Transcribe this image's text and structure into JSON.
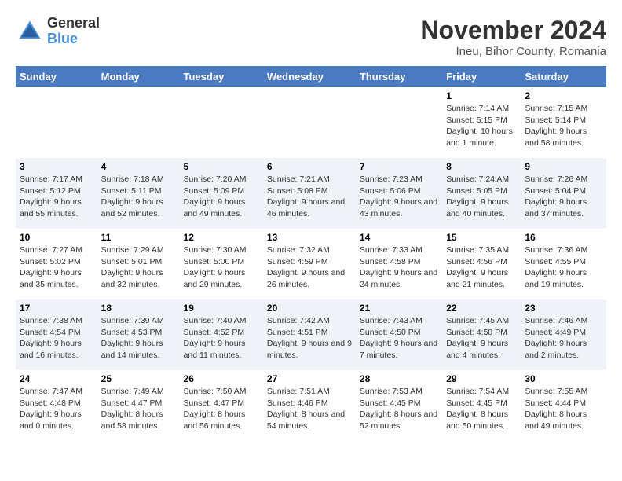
{
  "header": {
    "logo_line1": "General",
    "logo_line2": "Blue",
    "main_title": "November 2024",
    "subtitle": "Ineu, Bihor County, Romania"
  },
  "calendar": {
    "days_of_week": [
      "Sunday",
      "Monday",
      "Tuesday",
      "Wednesday",
      "Thursday",
      "Friday",
      "Saturday"
    ],
    "weeks": [
      [
        {
          "day": "",
          "info": ""
        },
        {
          "day": "",
          "info": ""
        },
        {
          "day": "",
          "info": ""
        },
        {
          "day": "",
          "info": ""
        },
        {
          "day": "",
          "info": ""
        },
        {
          "day": "1",
          "info": "Sunrise: 7:14 AM\nSunset: 5:15 PM\nDaylight: 10 hours and 1 minute."
        },
        {
          "day": "2",
          "info": "Sunrise: 7:15 AM\nSunset: 5:14 PM\nDaylight: 9 hours and 58 minutes."
        }
      ],
      [
        {
          "day": "3",
          "info": "Sunrise: 7:17 AM\nSunset: 5:12 PM\nDaylight: 9 hours and 55 minutes."
        },
        {
          "day": "4",
          "info": "Sunrise: 7:18 AM\nSunset: 5:11 PM\nDaylight: 9 hours and 52 minutes."
        },
        {
          "day": "5",
          "info": "Sunrise: 7:20 AM\nSunset: 5:09 PM\nDaylight: 9 hours and 49 minutes."
        },
        {
          "day": "6",
          "info": "Sunrise: 7:21 AM\nSunset: 5:08 PM\nDaylight: 9 hours and 46 minutes."
        },
        {
          "day": "7",
          "info": "Sunrise: 7:23 AM\nSunset: 5:06 PM\nDaylight: 9 hours and 43 minutes."
        },
        {
          "day": "8",
          "info": "Sunrise: 7:24 AM\nSunset: 5:05 PM\nDaylight: 9 hours and 40 minutes."
        },
        {
          "day": "9",
          "info": "Sunrise: 7:26 AM\nSunset: 5:04 PM\nDaylight: 9 hours and 37 minutes."
        }
      ],
      [
        {
          "day": "10",
          "info": "Sunrise: 7:27 AM\nSunset: 5:02 PM\nDaylight: 9 hours and 35 minutes."
        },
        {
          "day": "11",
          "info": "Sunrise: 7:29 AM\nSunset: 5:01 PM\nDaylight: 9 hours and 32 minutes."
        },
        {
          "day": "12",
          "info": "Sunrise: 7:30 AM\nSunset: 5:00 PM\nDaylight: 9 hours and 29 minutes."
        },
        {
          "day": "13",
          "info": "Sunrise: 7:32 AM\nSunset: 4:59 PM\nDaylight: 9 hours and 26 minutes."
        },
        {
          "day": "14",
          "info": "Sunrise: 7:33 AM\nSunset: 4:58 PM\nDaylight: 9 hours and 24 minutes."
        },
        {
          "day": "15",
          "info": "Sunrise: 7:35 AM\nSunset: 4:56 PM\nDaylight: 9 hours and 21 minutes."
        },
        {
          "day": "16",
          "info": "Sunrise: 7:36 AM\nSunset: 4:55 PM\nDaylight: 9 hours and 19 minutes."
        }
      ],
      [
        {
          "day": "17",
          "info": "Sunrise: 7:38 AM\nSunset: 4:54 PM\nDaylight: 9 hours and 16 minutes."
        },
        {
          "day": "18",
          "info": "Sunrise: 7:39 AM\nSunset: 4:53 PM\nDaylight: 9 hours and 14 minutes."
        },
        {
          "day": "19",
          "info": "Sunrise: 7:40 AM\nSunset: 4:52 PM\nDaylight: 9 hours and 11 minutes."
        },
        {
          "day": "20",
          "info": "Sunrise: 7:42 AM\nSunset: 4:51 PM\nDaylight: 9 hours and 9 minutes."
        },
        {
          "day": "21",
          "info": "Sunrise: 7:43 AM\nSunset: 4:50 PM\nDaylight: 9 hours and 7 minutes."
        },
        {
          "day": "22",
          "info": "Sunrise: 7:45 AM\nSunset: 4:50 PM\nDaylight: 9 hours and 4 minutes."
        },
        {
          "day": "23",
          "info": "Sunrise: 7:46 AM\nSunset: 4:49 PM\nDaylight: 9 hours and 2 minutes."
        }
      ],
      [
        {
          "day": "24",
          "info": "Sunrise: 7:47 AM\nSunset: 4:48 PM\nDaylight: 9 hours and 0 minutes."
        },
        {
          "day": "25",
          "info": "Sunrise: 7:49 AM\nSunset: 4:47 PM\nDaylight: 8 hours and 58 minutes."
        },
        {
          "day": "26",
          "info": "Sunrise: 7:50 AM\nSunset: 4:47 PM\nDaylight: 8 hours and 56 minutes."
        },
        {
          "day": "27",
          "info": "Sunrise: 7:51 AM\nSunset: 4:46 PM\nDaylight: 8 hours and 54 minutes."
        },
        {
          "day": "28",
          "info": "Sunrise: 7:53 AM\nSunset: 4:45 PM\nDaylight: 8 hours and 52 minutes."
        },
        {
          "day": "29",
          "info": "Sunrise: 7:54 AM\nSunset: 4:45 PM\nDaylight: 8 hours and 50 minutes."
        },
        {
          "day": "30",
          "info": "Sunrise: 7:55 AM\nSunset: 4:44 PM\nDaylight: 8 hours and 49 minutes."
        }
      ]
    ]
  }
}
